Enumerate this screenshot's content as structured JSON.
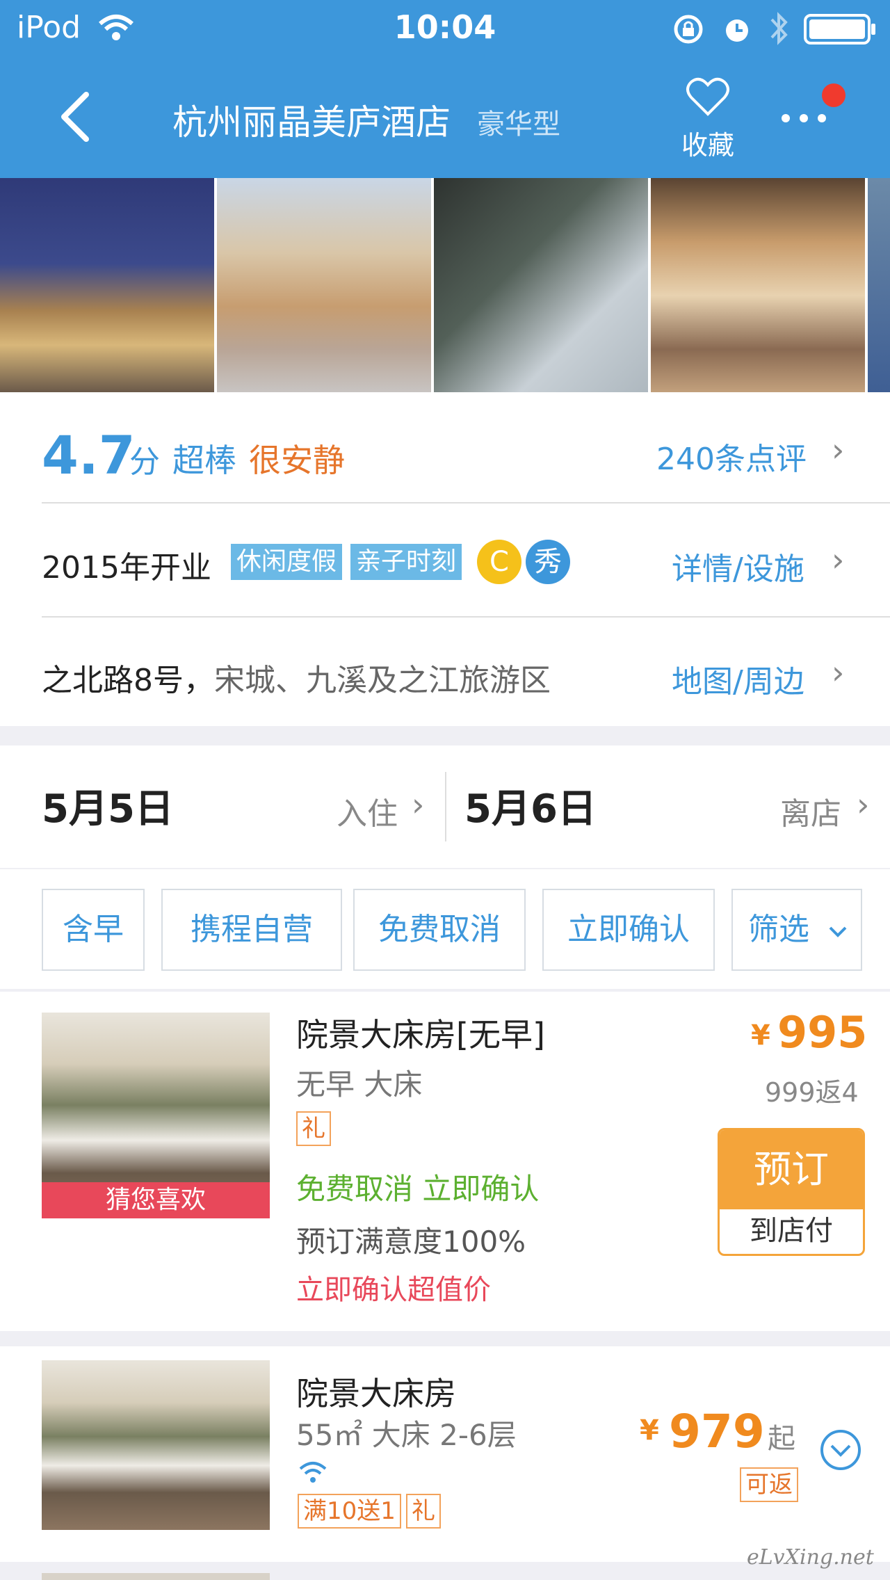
{
  "status_bar": {
    "carrier": "iPod",
    "time": "10:04"
  },
  "nav": {
    "title": "杭州丽晶美庐酒店",
    "type": "豪华型",
    "favorite_label": "收藏"
  },
  "colors": {
    "accent": "#3d97db",
    "orange": "#f08a1e",
    "green": "#5cb030",
    "red": "#e8485a"
  },
  "rating": {
    "score": "4.7",
    "unit": "分",
    "label": "超棒",
    "tag": "很安静",
    "reviews_link": "240条点评"
  },
  "facilities": {
    "opened": "2015年开业",
    "tags": [
      "休闲度假",
      "亲子时刻"
    ],
    "badge_gold": "C",
    "badge_show": "秀",
    "link": "详情/设施"
  },
  "location": {
    "road": "之北路8号，",
    "area": "宋城、九溪及之江旅游区",
    "link": "地图/周边"
  },
  "dates": {
    "checkin_date": "5月5日",
    "checkin_label": "入住",
    "checkout_date": "5月6日",
    "checkout_label": "离店"
  },
  "filters": [
    "含早",
    "携程自营",
    "免费取消",
    "立即确认",
    "筛选"
  ],
  "rooms": [
    {
      "name": "院景大床房[无早]",
      "sub": "无早  大床",
      "gift": "礼",
      "guess": "猜您喜欢",
      "perks": "免费取消  立即确认",
      "satisfaction": "预订满意度100%",
      "promo": "立即确认超值价",
      "currency": "¥",
      "price": "995",
      "original": "999返4",
      "book_label": "预订",
      "pay_label": "到店付"
    },
    {
      "name": "院景大床房",
      "sub": "55㎡ 大床 2-6层",
      "promo_tag": "满10送1",
      "gift": "礼",
      "currency": "¥",
      "price": "979",
      "suffix": "起",
      "cashback": "可返"
    }
  ],
  "watermark": "eLvXing.net"
}
